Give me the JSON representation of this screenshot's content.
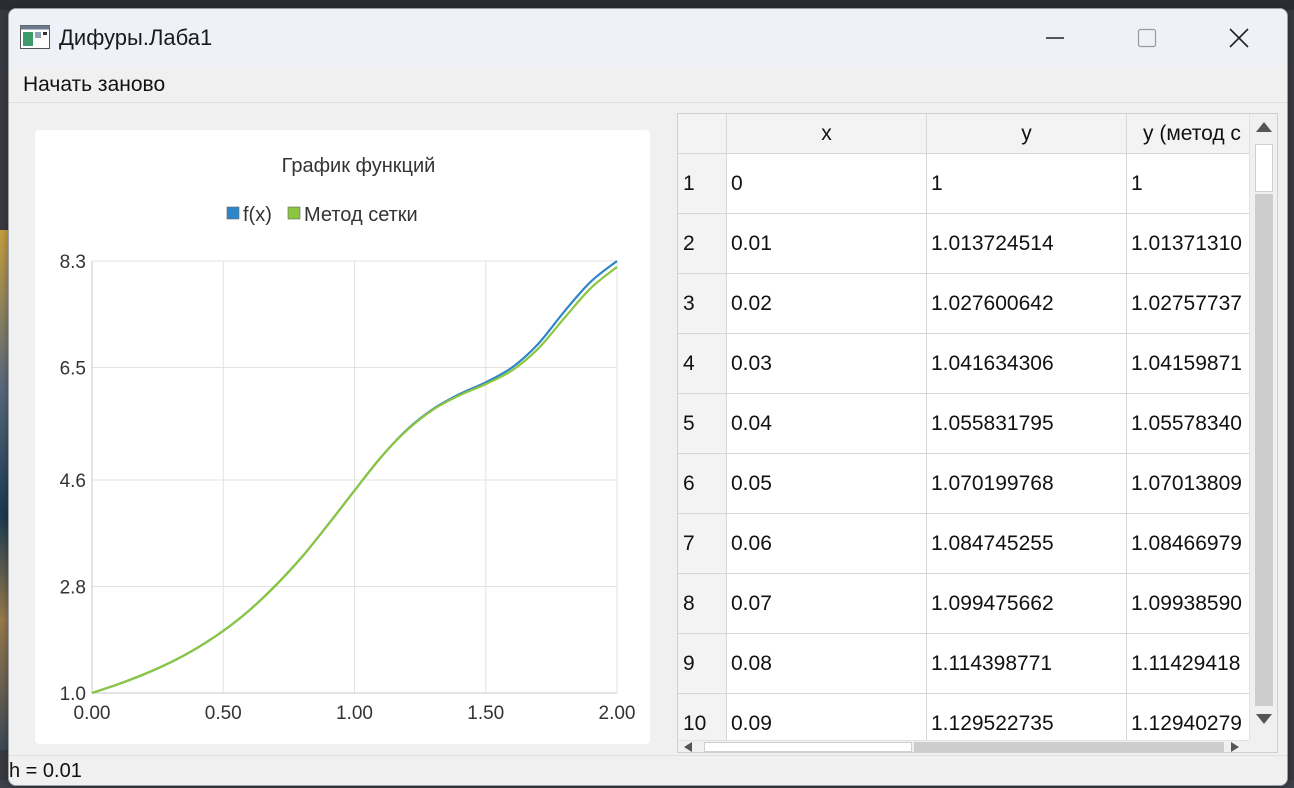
{
  "window": {
    "title": "Дифуры.Лаба1"
  },
  "menu": {
    "restart_label": "Начать заново"
  },
  "chart_data": {
    "type": "line",
    "title": "График функций",
    "xlabel": "",
    "ylabel": "",
    "xlim": [
      0,
      2
    ],
    "ylim": [
      1.0,
      8.3
    ],
    "x_ticks": [
      "0.00",
      "0.50",
      "1.00",
      "1.50",
      "2.00"
    ],
    "y_ticks": [
      "1.0",
      "2.8",
      "4.6",
      "6.5",
      "8.3"
    ],
    "grid": true,
    "legend_position": "top-center",
    "series": [
      {
        "name": "f(x)",
        "color": "#2e86c9",
        "x": [
          0,
          0.1,
          0.2,
          0.3,
          0.4,
          0.5,
          0.6,
          0.7,
          0.8,
          0.9,
          1.0,
          1.1,
          1.2,
          1.3,
          1.4,
          1.5,
          1.6,
          1.7,
          1.8,
          1.9,
          2.0
        ],
        "y": [
          1.0,
          1.15,
          1.32,
          1.52,
          1.76,
          2.05,
          2.4,
          2.82,
          3.3,
          3.85,
          4.42,
          4.98,
          5.45,
          5.8,
          6.05,
          6.25,
          6.5,
          6.9,
          7.45,
          7.95,
          8.3
        ]
      },
      {
        "name": "Метод сетки",
        "color": "#8cc63f",
        "x": [
          0,
          0.1,
          0.2,
          0.3,
          0.4,
          0.5,
          0.6,
          0.7,
          0.8,
          0.9,
          1.0,
          1.1,
          1.2,
          1.3,
          1.4,
          1.5,
          1.6,
          1.7,
          1.8,
          1.9,
          2.0
        ],
        "y": [
          1.0,
          1.15,
          1.32,
          1.52,
          1.76,
          2.05,
          2.4,
          2.82,
          3.3,
          3.85,
          4.42,
          4.98,
          5.44,
          5.79,
          6.03,
          6.22,
          6.45,
          6.82,
          7.34,
          7.84,
          8.2
        ]
      }
    ]
  },
  "table": {
    "columns": [
      "x",
      "y",
      "y (метод с"
    ],
    "rows": [
      {
        "index": "1",
        "x": "0",
        "y": "1",
        "y_grid": "1"
      },
      {
        "index": "2",
        "x": "0.01",
        "y": "1.013724514",
        "y_grid": "1.01371310"
      },
      {
        "index": "3",
        "x": "0.02",
        "y": "1.027600642",
        "y_grid": "1.02757737"
      },
      {
        "index": "4",
        "x": "0.03",
        "y": "1.041634306",
        "y_grid": "1.04159871"
      },
      {
        "index": "5",
        "x": "0.04",
        "y": "1.055831795",
        "y_grid": "1.05578340"
      },
      {
        "index": "6",
        "x": "0.05",
        "y": "1.070199768",
        "y_grid": "1.07013809"
      },
      {
        "index": "7",
        "x": "0.06",
        "y": "1.084745255",
        "y_grid": "1.08466979"
      },
      {
        "index": "8",
        "x": "0.07",
        "y": "1.099475662",
        "y_grid": "1.09938590"
      },
      {
        "index": "9",
        "x": "0.08",
        "y": "1.114398771",
        "y_grid": "1.11429418"
      },
      {
        "index": "10",
        "x": "0.09",
        "y": "1.129522735",
        "y_grid": "1.12940279"
      }
    ]
  },
  "status": {
    "text": "h = 0.01"
  },
  "icons": {
    "app": "app-window-icon",
    "minimize": "minimize-icon",
    "maximize": "maximize-icon",
    "close": "close-icon"
  }
}
